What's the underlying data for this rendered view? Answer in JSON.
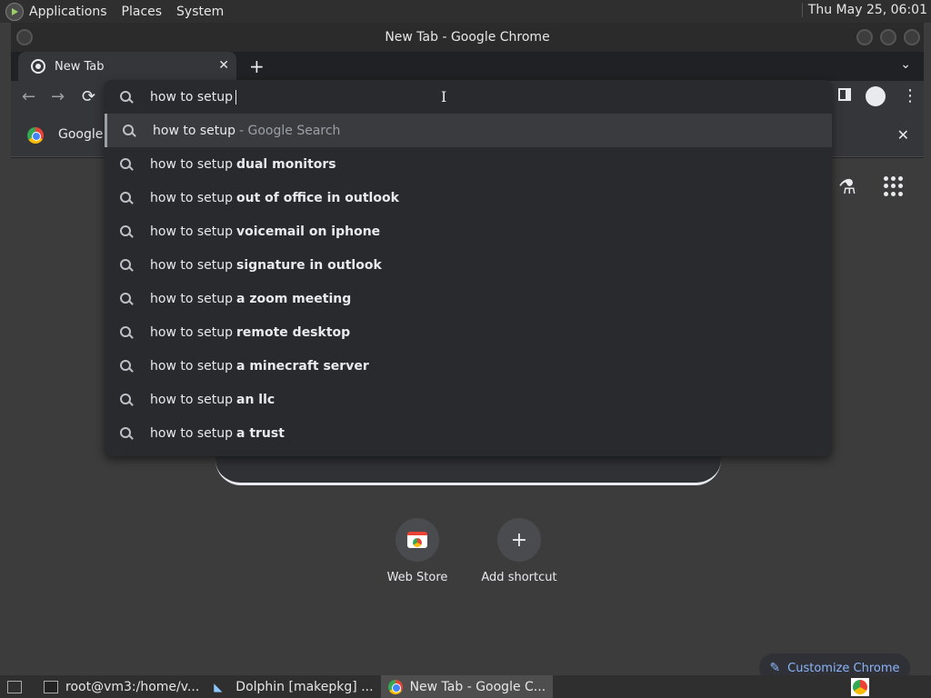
{
  "top_panel": {
    "menus": [
      "Applications",
      "Places",
      "System"
    ],
    "clock": "Thu May 25, 06:01"
  },
  "window": {
    "title": "New Tab - Google Chrome"
  },
  "tabs": [
    {
      "label": "New Tab"
    }
  ],
  "bookmarks_bar": {
    "item_label": "Google C"
  },
  "omnibox": {
    "input_value": "how to setup",
    "suggestions": [
      {
        "prefix": "how to setup",
        "bold": "",
        "hint": "- Google Search"
      },
      {
        "prefix": "how to setup",
        "bold": "dual monitors",
        "hint": ""
      },
      {
        "prefix": "how to setup",
        "bold": "out of office in outlook",
        "hint": ""
      },
      {
        "prefix": "how to setup",
        "bold": "voicemail on iphone",
        "hint": ""
      },
      {
        "prefix": "how to setup",
        "bold": "signature in outlook",
        "hint": ""
      },
      {
        "prefix": "how to setup",
        "bold": "a zoom meeting",
        "hint": ""
      },
      {
        "prefix": "how to setup",
        "bold": "remote desktop",
        "hint": ""
      },
      {
        "prefix": "how to setup",
        "bold": "a minecraft server",
        "hint": ""
      },
      {
        "prefix": "how to setup",
        "bold": "an llc",
        "hint": ""
      },
      {
        "prefix": "how to setup",
        "bold": "a trust",
        "hint": ""
      }
    ]
  },
  "new_tab_page": {
    "shortcuts": [
      {
        "label": "Web Store"
      },
      {
        "label": "Add shortcut"
      }
    ],
    "customize_label": "Customize Chrome"
  },
  "taskbar": {
    "items": [
      {
        "label": "root@vm3:/home/v..."
      },
      {
        "label": "Dolphin [makepkg] ..."
      },
      {
        "label": "New Tab - Google C..."
      }
    ]
  },
  "colors": {
    "accent_link": "#8ab4f8",
    "omnibox_bg": "#292a2d",
    "toolbar_bg": "#35363a"
  }
}
